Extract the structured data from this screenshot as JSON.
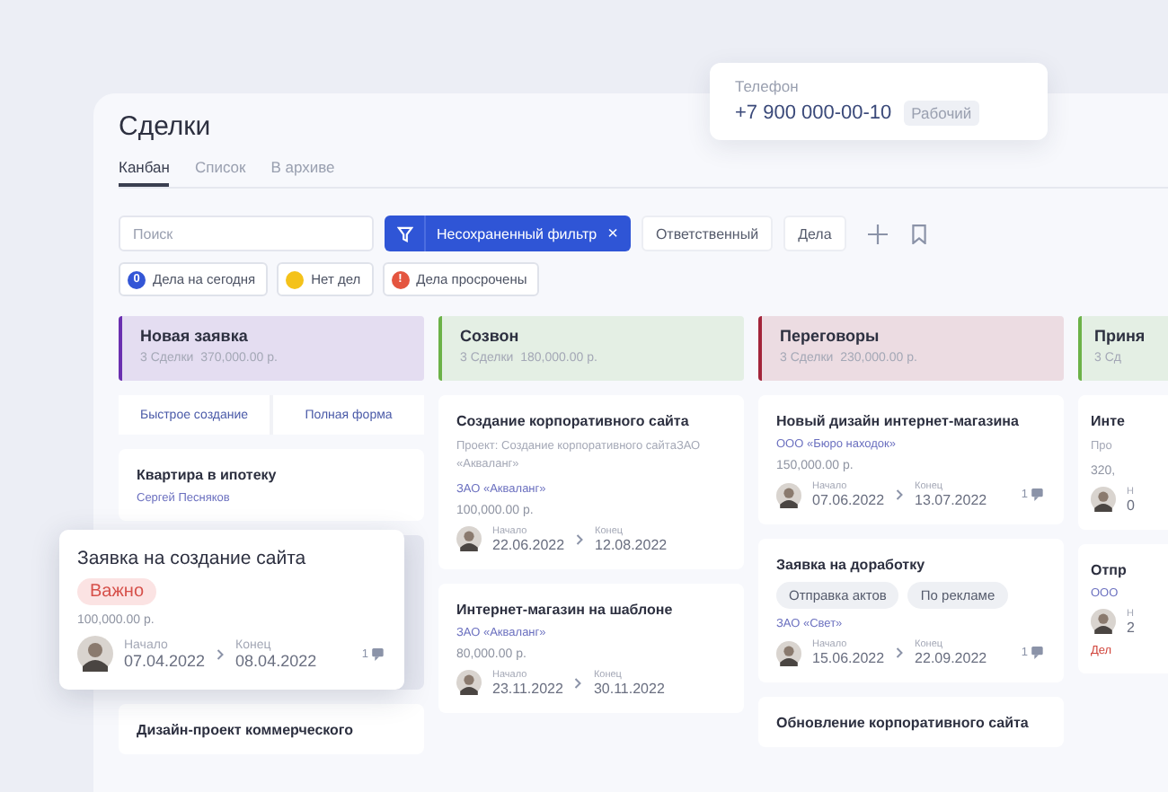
{
  "page_title": "Сделки",
  "tabs": [
    {
      "label": "Канбан",
      "selected": true
    },
    {
      "label": "Список",
      "selected": false
    },
    {
      "label": "В архиве",
      "selected": false
    }
  ],
  "search": {
    "placeholder": "Поиск"
  },
  "filter_chip": {
    "label": "Несохраненный фильтр",
    "close": "×"
  },
  "filter_buttons": [
    "Ответственный",
    "Дела"
  ],
  "activity_filters": [
    {
      "count": "0",
      "label": "Дела на сегодня",
      "color": "#3356d6"
    },
    {
      "label": "Нет дел",
      "color": "#f4c21a"
    },
    {
      "count": "!",
      "label": "Дела просрочены",
      "color": "#e4553f"
    }
  ],
  "columns": [
    {
      "title": "Новая заявка",
      "summary": "3 Сделки  370,000.00 р.",
      "color": "#6a2fb0",
      "quick_actions": [
        "Быстрое создание",
        "Полная форма"
      ],
      "cards": [
        {
          "kind": "deal",
          "title": "Квартира в ипотеку",
          "contact": "Сергей Песняков"
        },
        {
          "kind": "slot"
        },
        {
          "kind": "deal",
          "title": "Дизайн-проект коммерческого"
        }
      ]
    },
    {
      "title": "Созвон",
      "summary": "3 Сделки  180,000.00 р.",
      "color": "#6cb248",
      "cards": [
        {
          "kind": "deal",
          "title": "Создание корпоративного сайта",
          "project": "Проект: Создание корпоративного сайтаЗАО «Акваланг»",
          "company": "ЗАО «Акваланг»",
          "amount": "100,000.00 р.",
          "start_label": "Начало",
          "start_date": "22.06.2022",
          "end_label": "Конец",
          "end_date": "12.08.2022"
        },
        {
          "kind": "deal",
          "title": "Интернет-магазин на шаблоне",
          "company": "ЗАО «Акваланг»",
          "amount": "80,000.00 р.",
          "start_label": "Начало",
          "start_date": "23.11.2022",
          "end_label": "Конец",
          "end_date": "30.11.2022"
        }
      ]
    },
    {
      "title": "Переговоры",
      "summary": "3 Сделки  230,000.00 р.",
      "color": "#a3253a",
      "cards": [
        {
          "kind": "deal",
          "title": "Новый дизайн интернет-магазина",
          "company": "ООО «Бюро находок»",
          "amount": "150,000.00 р.",
          "start_label": "Начало",
          "start_date": "07.06.2022",
          "end_label": "Конец",
          "end_date": "13.07.2022",
          "comments": "1"
        },
        {
          "kind": "deal",
          "title": "Заявка на доработку",
          "tags": [
            "Отправка актов",
            "По рекламе"
          ],
          "company": "ЗАО «Свет»",
          "start_label": "Начало",
          "start_date": "15.06.2022",
          "end_label": "Конец",
          "end_date": "22.09.2022",
          "comments": "1"
        },
        {
          "kind": "deal",
          "title": "Обновление корпоративного сайта"
        }
      ]
    },
    {
      "title": "Приня",
      "summary": "3 Сд",
      "color": "#6cb248",
      "cards": [
        {
          "kind": "deal",
          "title": "Инте",
          "project": "Про",
          "amount": "320,",
          "start_label": "Н",
          "start_date": "0"
        },
        {
          "kind": "deal",
          "title": "Отпр",
          "company": "ООО",
          "start_label": "Н",
          "start_date": "2",
          "overdue": "Дел"
        }
      ]
    }
  ],
  "dragged_card": {
    "title": "Заявка на создание сайта",
    "tag": "Важно",
    "amount": "100,000.00 р.",
    "start_label": "Начало",
    "start_date": "07.04.2022",
    "end_label": "Конец",
    "end_date": "08.04.2022",
    "comments": "1"
  },
  "phone_popup": {
    "label": "Телефон",
    "number": "+7 900 000-00-10",
    "type": "Рабочий"
  }
}
